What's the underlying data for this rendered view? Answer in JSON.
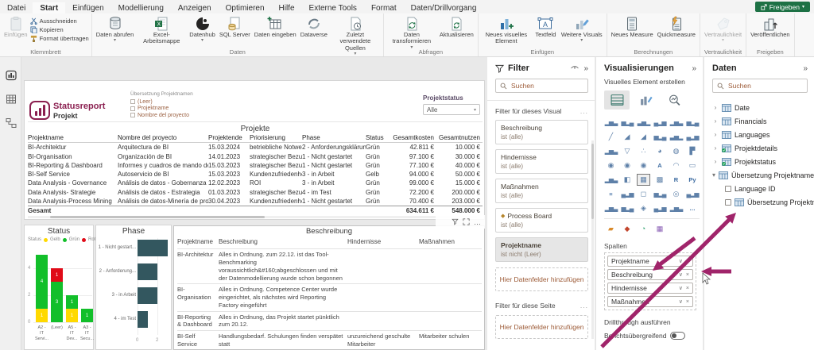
{
  "colors": {
    "accent": "#8a1e4f",
    "arrow": "#a0246a",
    "share_green": "#1d7145",
    "gelb": "#ffd900",
    "gruen": "#12bf2a",
    "rot": "#e00b18",
    "phase_bar": "#33575f"
  },
  "ribbon": {
    "tabs": [
      {
        "label": "Datei"
      },
      {
        "label": "Start",
        "active": true
      },
      {
        "label": "Einfügen"
      },
      {
        "label": "Modellierung"
      },
      {
        "label": "Anzeigen"
      },
      {
        "label": "Optimieren"
      },
      {
        "label": "Hilfe"
      },
      {
        "label": "Externe Tools"
      },
      {
        "label": "Format"
      },
      {
        "label": "Daten/Drillvorgang"
      }
    ],
    "share_label": "Freigeben",
    "collapse_glyph": "▴",
    "groups": [
      {
        "label": "Klemmbrett",
        "items": [
          {
            "label": "Einfügen",
            "icon": "paste-icon",
            "disabled": true
          },
          {
            "label": "Ausschneiden",
            "icon": "scissors-icon",
            "small": true
          },
          {
            "label": "Kopieren",
            "icon": "copy-icon",
            "small": true
          },
          {
            "label": "Format übertragen",
            "icon": "format-painter-icon",
            "small": true
          }
        ]
      },
      {
        "label": "Daten",
        "items": [
          {
            "label": "Daten abrufen",
            "icon": "get-data-icon",
            "dd": true
          },
          {
            "label": "Excel-Arbeitsmappe",
            "icon": "excel-icon"
          },
          {
            "label": "Datenhub",
            "icon": "datahub-icon",
            "dd": true
          },
          {
            "label": "SQL Server",
            "icon": "sql-server-icon"
          },
          {
            "label": "Daten eingeben",
            "icon": "enter-data-icon"
          },
          {
            "label": "Dataverse",
            "icon": "dataverse-icon"
          },
          {
            "label": "Zuletzt verwendete Quellen",
            "icon": "recent-sources-icon",
            "dd": true
          }
        ]
      },
      {
        "label": "Abfragen",
        "items": [
          {
            "label": "Daten transformieren",
            "icon": "transform-data-icon",
            "dd": true
          },
          {
            "label": "Aktualisieren",
            "icon": "refresh-icon"
          }
        ]
      },
      {
        "label": "Einfügen",
        "items": [
          {
            "label": "Neues visuelles Element",
            "icon": "new-visual-icon"
          },
          {
            "label": "Textfeld",
            "icon": "textbox-icon"
          },
          {
            "label": "Weitere Visuals",
            "icon": "more-visuals-icon",
            "dd": true
          }
        ]
      },
      {
        "label": "Berechnungen",
        "items": [
          {
            "label": "Neues Measure",
            "icon": "new-measure-icon"
          },
          {
            "label": "Quickmeasure",
            "icon": "quick-measure-icon"
          }
        ]
      },
      {
        "label": "Vertraulichkeit",
        "items": [
          {
            "label": "Vertraulichkeit",
            "icon": "sensitivity-icon",
            "disabled": true,
            "dd": true
          }
        ]
      },
      {
        "label": "Freigeben",
        "items": [
          {
            "label": "Veröffentlichen",
            "icon": "publish-icon"
          }
        ]
      }
    ]
  },
  "view_nav": [
    "report-view",
    "data-view",
    "model-view"
  ],
  "canvas": {
    "logo_title": "Statusreport",
    "logo_subtitle": "Projekt",
    "slicer": {
      "title": "Übersetzung Projektnamen",
      "options": [
        "(Leer)",
        "Projektname",
        "Nombre del proyecto"
      ]
    },
    "projektstatus": {
      "label": "Projektstatus",
      "value": "Alle"
    },
    "projekte_table": {
      "title": "Projekte",
      "columns": [
        "Projektname",
        "Nombre del proyecto",
        "Projektende",
        "Priorisierung",
        "Phase",
        "Status",
        "Gesamtkosten",
        "Gesamtnutzen"
      ],
      "rows": [
        [
          "BI-Architektur",
          "Arquitectura de BI",
          "15.03.2024",
          "betriebliche Notwe...",
          "2 - Anforderungsklärung",
          "Grün",
          "42.811 €",
          "10.000 €"
        ],
        [
          "BI-Organisation",
          "Organización de BI",
          "14.01.2023",
          "strategischer Bezug",
          "1 - Nicht gestartet",
          "Grün",
          "97.100 €",
          "30.000 €"
        ],
        [
          "BI-Reporting & Dashboard",
          "Informes y cuadros de mando de BI",
          "15.03.2023",
          "strategischer Bezug",
          "1 - Nicht gestartet",
          "Grün",
          "77.100 €",
          "40.000 €"
        ],
        [
          "BI-Self Service",
          "Autoservicio de BI",
          "15.03.2023",
          "Kundenzufriedenheit",
          "3 - in Arbeit",
          "Gelb",
          "94.000 €",
          "50.000 €"
        ],
        [
          "Data Analysis - Governance",
          "Análisis de datos - Gobernanza",
          "12.02.2023",
          "ROI",
          "3 - in Arbeit",
          "Grün",
          "99.000 €",
          "15.000 €"
        ],
        [
          "Data Analysis- Strategie",
          "Análisis de datos - Estrategia",
          "01.03.2023",
          "strategischer Bezug",
          "4 - im Test",
          "Grün",
          "72.200 €",
          "200.000 €"
        ],
        [
          "Data Analysis-Process Mining",
          "Análisis de datos-Minería de procesos",
          "30.04.2023",
          "Kundenzufriedenheit",
          "1 - Nicht gestartet",
          "Grün",
          "70.400 €",
          "203.000 €"
        ]
      ],
      "total_label": "Gesamt",
      "total_kosten": "634.611 €",
      "total_nutzen": "548.000 €"
    },
    "beschreibung_table": {
      "title": "Beschreibung",
      "columns": [
        "Projektname",
        "Beschreibung",
        "Hindernisse",
        "Maßnahmen"
      ],
      "rows": [
        {
          "projekt": "BI-Architektur",
          "beschreibung": "Alles in Ordnung. zum 22.12. ist das Tool-Benchmarking voraussichtlich&#160;abgeschlossen und mit der Datenmodellierung wurde schon begonnen",
          "hindernisse": "",
          "massnahmen": ""
        },
        {
          "projekt": "BI-Organisation",
          "beschreibung": "Alles in Ordnung. Competence Center wurde eingerichtet, als nächstes wird Reporting Factory eingeführt",
          "hindernisse": "",
          "massnahmen": ""
        },
        {
          "projekt": "BI-Reporting & Dashboard",
          "beschreibung": "Alles in Ordnung, das Projekt startet pünktlich zum 20.12.",
          "hindernisse": "",
          "massnahmen": ""
        },
        {
          "projekt": "BI-Self Service",
          "beschreibung": "Handlungsbedarf. Schulungen finden verspätet statt",
          "hindernisse": "unzureichend geschulte Mitarbeiter",
          "massnahmen": "Mitarbeiter schulen"
        }
      ]
    }
  },
  "chart_data": [
    {
      "type": "bar",
      "stacked": true,
      "title": "Status",
      "legend": {
        "title": "Status",
        "entries": [
          {
            "label": "Gelb",
            "color": "#ffd900"
          },
          {
            "label": "Grün",
            "color": "#12bf2a"
          },
          {
            "label": "Rot",
            "color": "#e00b18"
          }
        ]
      },
      "categories": [
        "A2 - IT Servi...",
        "(Leer)",
        "A5 - IT Dev...",
        "A3 - IT Secu..."
      ],
      "series": [
        {
          "name": "Gelb",
          "values": [
            1,
            0,
            1,
            0
          ]
        },
        {
          "name": "Grün",
          "values": [
            4,
            3,
            1,
            1
          ]
        },
        {
          "name": "Rot",
          "values": [
            0,
            1,
            0,
            0
          ]
        }
      ],
      "ylim": [
        0,
        5
      ],
      "yticks": [
        0,
        2,
        4
      ],
      "legend_position": "top"
    },
    {
      "type": "bar",
      "orientation": "horizontal",
      "title": "Phase",
      "categories": [
        "1 - Nicht gestart...",
        "2 - Anforderung...",
        "3 - in Arbeit",
        "4 - im Test"
      ],
      "values": [
        3,
        2,
        2,
        1
      ],
      "xticks": [
        0,
        2
      ],
      "xlim": [
        0,
        3
      ],
      "bar_color": "#33575f"
    }
  ],
  "filter_pane": {
    "title": "Filter",
    "search_placeholder": "Suchen",
    "section_visual": "Filter für dieses Visual",
    "section_page": "Filter für diese Seite",
    "add_fields": "Hier Datenfelder hinzufügen",
    "more_glyph": "...",
    "cards": [
      {
        "name": "Beschreibung",
        "condition": "ist (alle)"
      },
      {
        "name": "Hindernisse",
        "condition": "ist (alle)"
      },
      {
        "name": "Maßnahmen",
        "condition": "ist (alle)"
      },
      {
        "name": "Process Board",
        "condition": "ist (alle)",
        "icon": "diamond-icon"
      },
      {
        "name": "Projektname",
        "condition": "ist nicht (Leer)",
        "highlighted": true
      }
    ]
  },
  "vis_pane": {
    "title": "Visualisierungen",
    "subtitle": "Visuelles Element erstellen",
    "spalten_label": "Spalten",
    "fields": [
      "Projektname",
      "Beschreibung",
      "Hindernisse",
      "Maßnahmen"
    ],
    "drillthrough_label": "Drillthrough ausführen",
    "cross_report_label": "Berichtsübergreifend",
    "selected_icon": "table",
    "icons": [
      "stacked-bar-chart",
      "stacked-column-chart",
      "clustered-bar-chart",
      "clustered-column-chart",
      "100-stacked-bar-chart",
      "100-stacked-column-chart",
      "line-chart",
      "area-chart",
      "stacked-area-chart",
      "line-and-stacked-column-chart",
      "line-and-clustered-column-chart",
      "ribbon-chart",
      "waterfall-chart",
      "funnel-chart",
      "scatter-chart",
      "pie-chart",
      "donut-chart",
      "treemap",
      "map",
      "filled-map",
      "shape-map",
      "azure-map",
      "gauge",
      "card",
      "multi-row-card",
      "kpi",
      "table",
      "matrix",
      "r-script-visual",
      "python-visual",
      "decomposition-tree",
      "key-influencers",
      "qa-visual",
      "smart-narrative",
      "goals",
      "paginated-report",
      "power-apps",
      "power-automate",
      "process-board",
      "timeline",
      "advanced-card",
      "more-visuals"
    ],
    "custom_icons": [
      "custom-visual-1",
      "custom-visual-2",
      "custom-visual-3",
      "custom-visual-4"
    ]
  },
  "data_pane": {
    "title": "Daten",
    "search_placeholder": "Suchen",
    "tables": [
      {
        "label": "Date"
      },
      {
        "label": "Financials"
      },
      {
        "label": "Languages"
      },
      {
        "label": "Projektdetails",
        "checked_badge": true
      },
      {
        "label": "Projektstatus",
        "checked_badge": true
      },
      {
        "label": "Übersetzung Projektnamen",
        "expanded": true,
        "children": [
          {
            "label": "Language ID"
          },
          {
            "label": "Übersetzung Projektnamen",
            "icon": true
          }
        ]
      }
    ]
  }
}
